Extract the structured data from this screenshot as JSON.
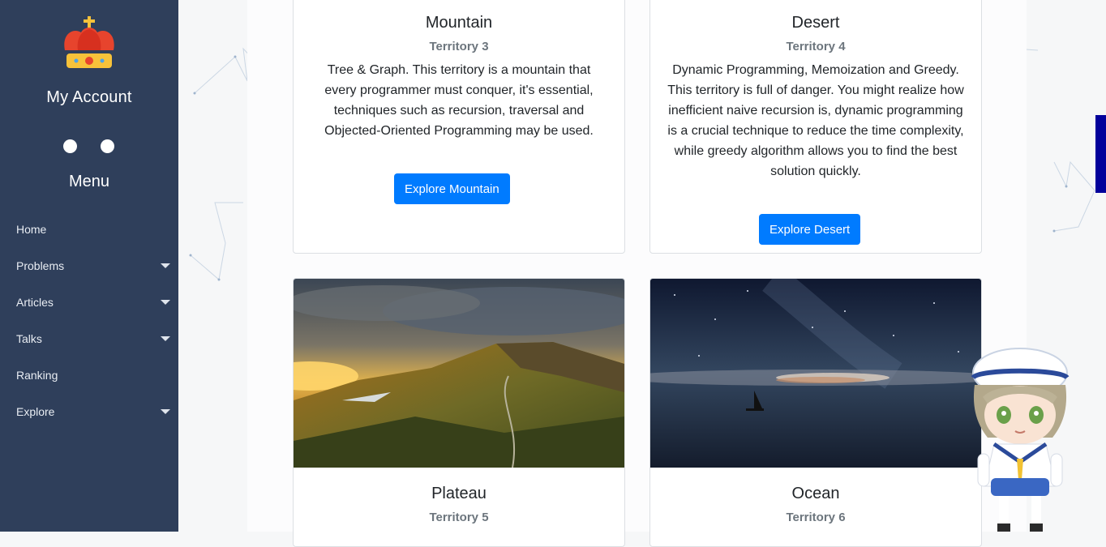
{
  "sidebar": {
    "account_title": "My Account",
    "menu_title": "Menu",
    "logo_icon": "crown-icon",
    "items": [
      {
        "label": "Home",
        "has_dropdown": false
      },
      {
        "label": "Problems",
        "has_dropdown": true
      },
      {
        "label": "Articles",
        "has_dropdown": true
      },
      {
        "label": "Talks",
        "has_dropdown": true
      },
      {
        "label": "Ranking",
        "has_dropdown": false
      },
      {
        "label": "Explore",
        "has_dropdown": true
      }
    ]
  },
  "cards": [
    {
      "title": "Mountain",
      "subtitle": "Territory 3",
      "text": "Tree & Graph. This territory is a mountain that every programmer must conquer, it's essential, techniques such as recursion, traversal and Objected-Oriented Programming may be used.",
      "button": "Explore Mountain"
    },
    {
      "title": "Desert",
      "subtitle": "Territory 4",
      "text": "Dynamic Programming, Memoization and Greedy. This territory is full of danger. You might realize how inefficient naive recursion is, dynamic programming is a crucial technique to reduce the time complexity, while greedy algorithm allows you to find the best solution quickly.",
      "button": "Explore Desert"
    },
    {
      "title": "Plateau",
      "subtitle": "Territory 5",
      "image": "plateau-landscape-image"
    },
    {
      "title": "Ocean",
      "subtitle": "Territory 6",
      "image": "ocean-night-sky-image"
    }
  ],
  "colors": {
    "sidebar_bg": "#2f3f5b",
    "primary_button": "#007bff",
    "accent_tab": "#03009b"
  }
}
